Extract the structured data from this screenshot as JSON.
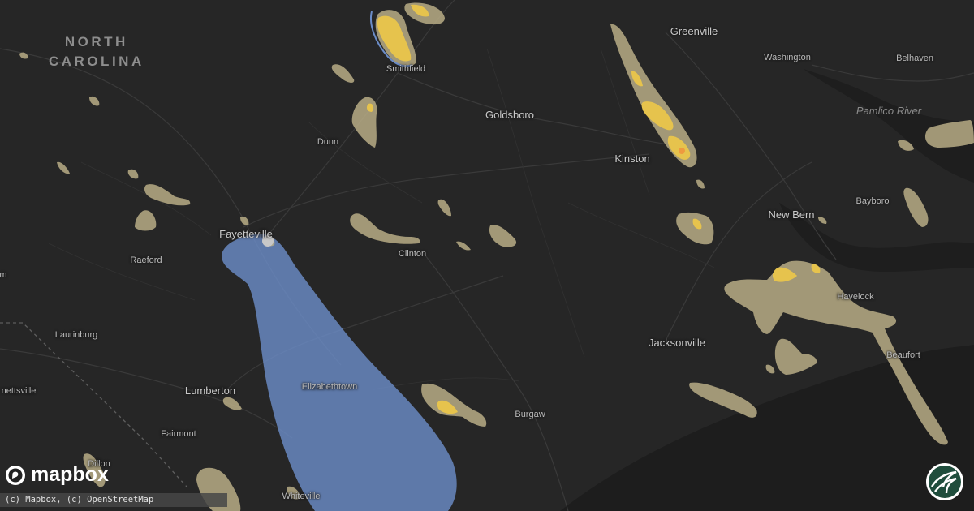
{
  "map": {
    "state_label": [
      "NORTH",
      "CAROLINA"
    ],
    "cities": [
      {
        "key": "greenville",
        "name": "Greenville"
      },
      {
        "key": "washington",
        "name": "Washington"
      },
      {
        "key": "belhaven",
        "name": "Belhaven"
      },
      {
        "key": "smithfield",
        "name": "Smithfield"
      },
      {
        "key": "goldsboro",
        "name": "Goldsboro"
      },
      {
        "key": "dunn",
        "name": "Dunn"
      },
      {
        "key": "kinston",
        "name": "Kinston"
      },
      {
        "key": "bayboro",
        "name": "Bayboro"
      },
      {
        "key": "new_bern",
        "name": "New Bern"
      },
      {
        "key": "fayetteville",
        "name": "Fayetteville"
      },
      {
        "key": "clinton",
        "name": "Clinton"
      },
      {
        "key": "raeford",
        "name": "Raeford"
      },
      {
        "key": "havelock",
        "name": "Havelock"
      },
      {
        "key": "laurinburg",
        "name": "Laurinburg"
      },
      {
        "key": "jacksonville",
        "name": "Jacksonville"
      },
      {
        "key": "beaufort",
        "name": "Beaufort"
      },
      {
        "key": "elizabethtown",
        "name": "Elizabethtown"
      },
      {
        "key": "lumberton",
        "name": "Lumberton"
      },
      {
        "key": "bennettsville",
        "name": "nettsville"
      },
      {
        "key": "burgaw",
        "name": "Burgaw"
      },
      {
        "key": "fairmont",
        "name": "Fairmont"
      },
      {
        "key": "dillon",
        "name": "Dillon"
      },
      {
        "key": "whiteville",
        "name": "Whiteville"
      },
      {
        "key": "edge_left",
        "name": "m"
      }
    ],
    "water_labels": [
      {
        "key": "pamlico_river",
        "name": "Pamlico River"
      }
    ],
    "hail_colors": {
      "light": "#b8ad86",
      "yellow": "#e6c34d",
      "orange": "#ee9a3f",
      "warning": "#6b8cc7"
    }
  },
  "branding": {
    "logo_text": "mapbox",
    "attribution": "(c) Mapbox, (c) OpenStreetMap",
    "badge_icon": "storm-badge-icon"
  }
}
